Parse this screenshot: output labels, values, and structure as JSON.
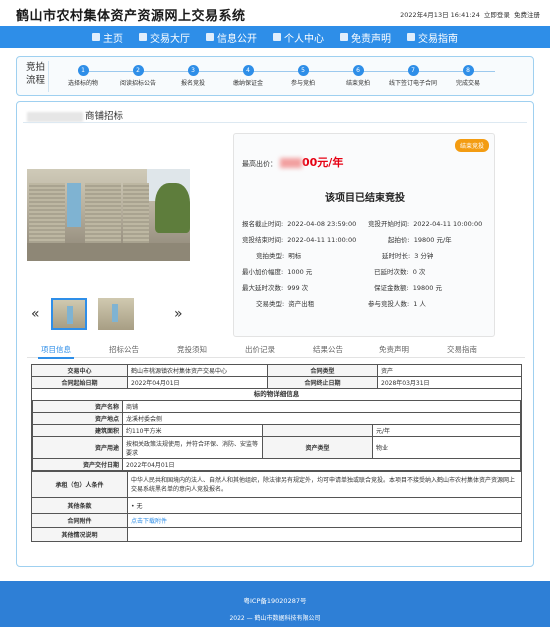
{
  "header": {
    "title": "鹤山市农村集体资产资源网上交易系统",
    "datetime": "2022年4月13日 16:41:24",
    "login": "立即登录",
    "register": "免费注册"
  },
  "nav": [
    {
      "label": "主页",
      "icon": "home-icon"
    },
    {
      "label": "交易大厅",
      "icon": "hall-icon"
    },
    {
      "label": "信息公开",
      "icon": "info-icon"
    },
    {
      "label": "个人中心",
      "icon": "user-icon"
    },
    {
      "label": "免责声明",
      "icon": "statement-icon"
    },
    {
      "label": "交易指南",
      "icon": "guide-icon"
    }
  ],
  "process": {
    "label": "竞拍流程",
    "steps": [
      {
        "num": "1",
        "label": "选择标的物"
      },
      {
        "num": "2",
        "label": "阅读招标公告"
      },
      {
        "num": "3",
        "label": "报名竞投"
      },
      {
        "num": "4",
        "label": "缴纳保证金"
      },
      {
        "num": "5",
        "label": "参与竞拍"
      },
      {
        "num": "6",
        "label": "结束竞拍"
      },
      {
        "num": "7",
        "label": "线下签订电子合同"
      },
      {
        "num": "8",
        "label": "完成交易"
      }
    ]
  },
  "property": {
    "title_suffix": "商铺招标",
    "badge": "结束竞投",
    "price_label": "最高出价：",
    "price_suffix": "00元/年",
    "status": "该项目已结束竞投",
    "details": [
      {
        "k": "报名截止时间:",
        "v": "2022-04-08 23:59:00"
      },
      {
        "k": "竞投开始时间:",
        "v": "2022-04-11 10:00:00"
      },
      {
        "k": "竞投结束时间:",
        "v": "2022-04-11 11:00:00"
      },
      {
        "k": "起拍价:",
        "v": "19800 元/年"
      },
      {
        "k": "竞拍类型:",
        "v": "明标"
      },
      {
        "k": "延时时长:",
        "v": "3 分钟"
      },
      {
        "k": "最小加价幅度:",
        "v": "1000 元"
      },
      {
        "k": "已延时次数:",
        "v": "0 次"
      },
      {
        "k": "最大延时次数:",
        "v": "999 次"
      },
      {
        "k": "保证金数额:",
        "v": "19800 元"
      },
      {
        "k": "交易类型:",
        "v": "资产出租"
      },
      {
        "k": "参与竞投人数:",
        "v": "1 人"
      }
    ]
  },
  "tabs": [
    "项目信息",
    "招标公告",
    "竞投须知",
    "出价记录",
    "结果公告",
    "免责声明",
    "交易指南"
  ],
  "table": {
    "trade_center_k": "交易中心",
    "trade_center_v": "鹤山市桃源镇农村集体资产交易中心",
    "contract_type_k": "合同类型",
    "contract_type_v": "资产",
    "start_date_k": "合同起始日期",
    "start_date_v": "2022年04月01日",
    "end_date_k": "合同终止日期",
    "end_date_v": "2028年03月31日",
    "section": "标的物详细信息",
    "asset_name_k": "资产名称",
    "asset_name_v": "商铺",
    "asset_loc_k": "资产地点",
    "asset_loc_v": "龙溪村委会侧",
    "area_k": "建筑面积",
    "area_v": "约110平方米",
    "price_v": "元/年",
    "use_k": "资产用途",
    "use_v": "按相关政策法规使用，并符合环保、消防、安监等要求",
    "asset_type_k": "资产类型",
    "asset_type_v": "物业",
    "delivery_k": "资产交付日期",
    "delivery_v": "2022年04月01日",
    "bidder_k": "承租（包）人条件",
    "bidder_v": "中华人民共和国境内的法人、自然人和其他组织，除法律另有规定外，均可申请单独或联合竞投。本项目不接受纳入鹤山市农村集体资产资源网上交易系统黑名单的意向人竞投报名。",
    "other_k": "其他条款",
    "other_v": "• 无",
    "attach_k": "合同附件",
    "attach_v": "点击下载附件",
    "extra_k": "其他情况说明",
    "extra_v": ""
  },
  "footer": {
    "icp": "粤ICP备19020287号",
    "copyright": "2022 — 鹤山市数据科技有限公司"
  }
}
